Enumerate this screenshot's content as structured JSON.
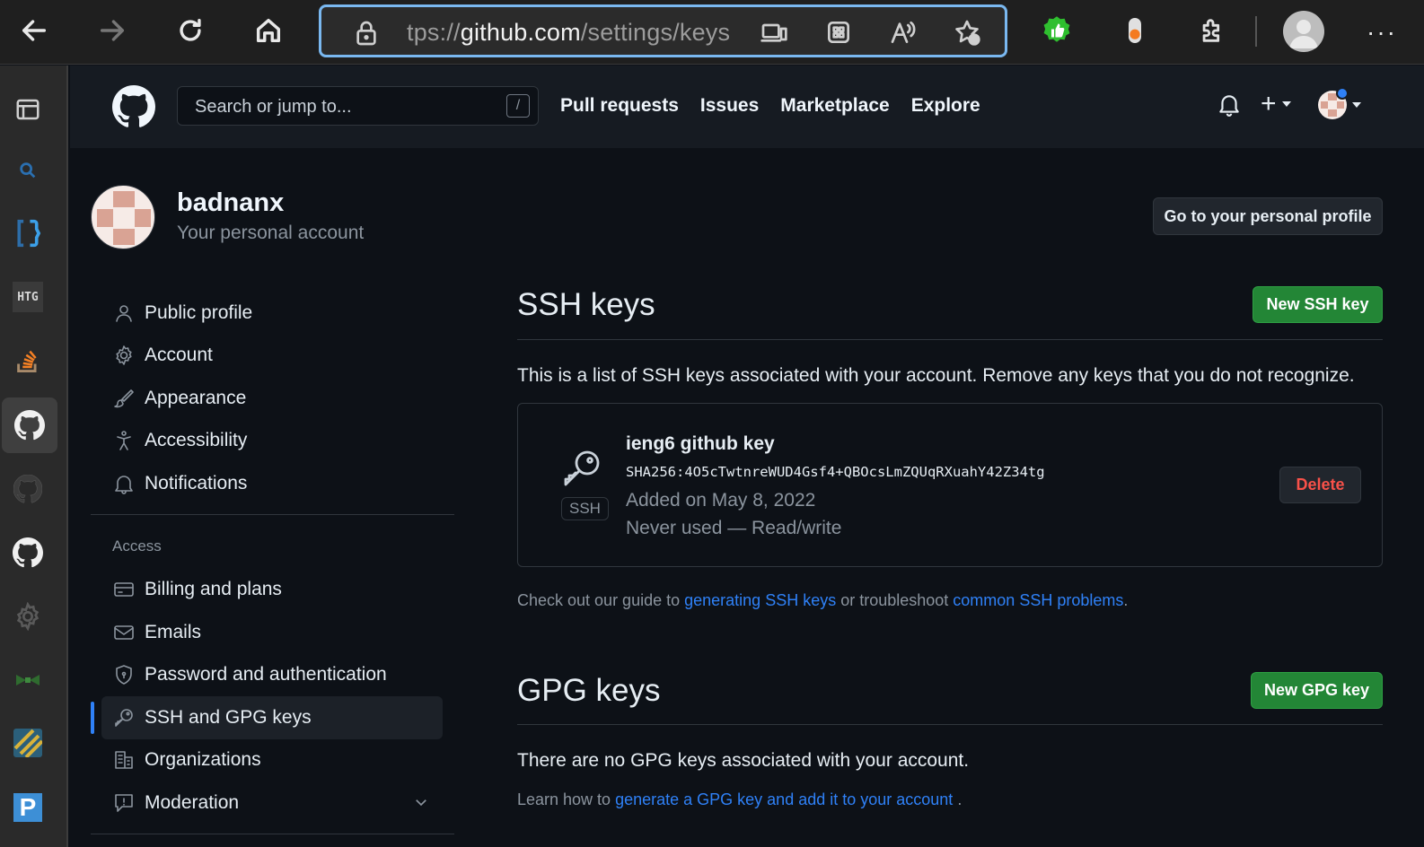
{
  "browser": {
    "url_prefix": "tps://",
    "url_host": "github.com",
    "url_path": "/settings/keys",
    "more_label": "···"
  },
  "header": {
    "search_placeholder": "Search or jump to...",
    "search_shortcut": "/",
    "nav": [
      "Pull requests",
      "Issues",
      "Marketplace",
      "Explore"
    ],
    "plus_label": "+"
  },
  "account": {
    "username": "badnanx",
    "subtitle": "Your personal account",
    "profile_button": "Go to your personal profile"
  },
  "menu": {
    "items_top": [
      {
        "label": "Public profile",
        "icon": "person-icon"
      },
      {
        "label": "Account",
        "icon": "gear-icon"
      },
      {
        "label": "Appearance",
        "icon": "paintbrush-icon"
      },
      {
        "label": "Accessibility",
        "icon": "accessibility-icon"
      },
      {
        "label": "Notifications",
        "icon": "bell-icon"
      }
    ],
    "access_heading": "Access",
    "items_access": [
      {
        "label": "Billing and plans",
        "icon": "credit-card-icon"
      },
      {
        "label": "Emails",
        "icon": "mail-icon"
      },
      {
        "label": "Password and authentication",
        "icon": "shield-icon"
      },
      {
        "label": "SSH and GPG keys",
        "icon": "key-icon"
      },
      {
        "label": "Organizations",
        "icon": "organization-icon"
      },
      {
        "label": "Moderation",
        "icon": "report-icon"
      }
    ]
  },
  "ssh": {
    "title": "SSH keys",
    "new_button": "New SSH key",
    "description": "This is a list of SSH keys associated with your account. Remove any keys that you do not recognize.",
    "key": {
      "badge": "SSH",
      "name": "ieng6 github key",
      "fingerprint": "SHA256:4O5cTwtnreWUD4Gsf4+QBOcsLmZQUqRXuahY42Z34tg",
      "added": "Added on May 8, 2022",
      "usage": "Never used — Read/write",
      "delete_button": "Delete"
    },
    "guide_prefix": "Check out our guide to ",
    "guide_link1": "generating SSH keys",
    "guide_middle": " or troubleshoot ",
    "guide_link2": "common SSH problems",
    "guide_suffix": "."
  },
  "gpg": {
    "title": "GPG keys",
    "new_button": "New GPG key",
    "empty_text": "There are no GPG keys associated with your account.",
    "learn_prefix": "Learn how to ",
    "learn_link": "generate a GPG key and add it to your account",
    "learn_suffix": " ."
  },
  "colors": {
    "accent": "#2f81f7",
    "green": "#238636",
    "danger": "#f85149",
    "address_border": "#7ab8f0"
  }
}
